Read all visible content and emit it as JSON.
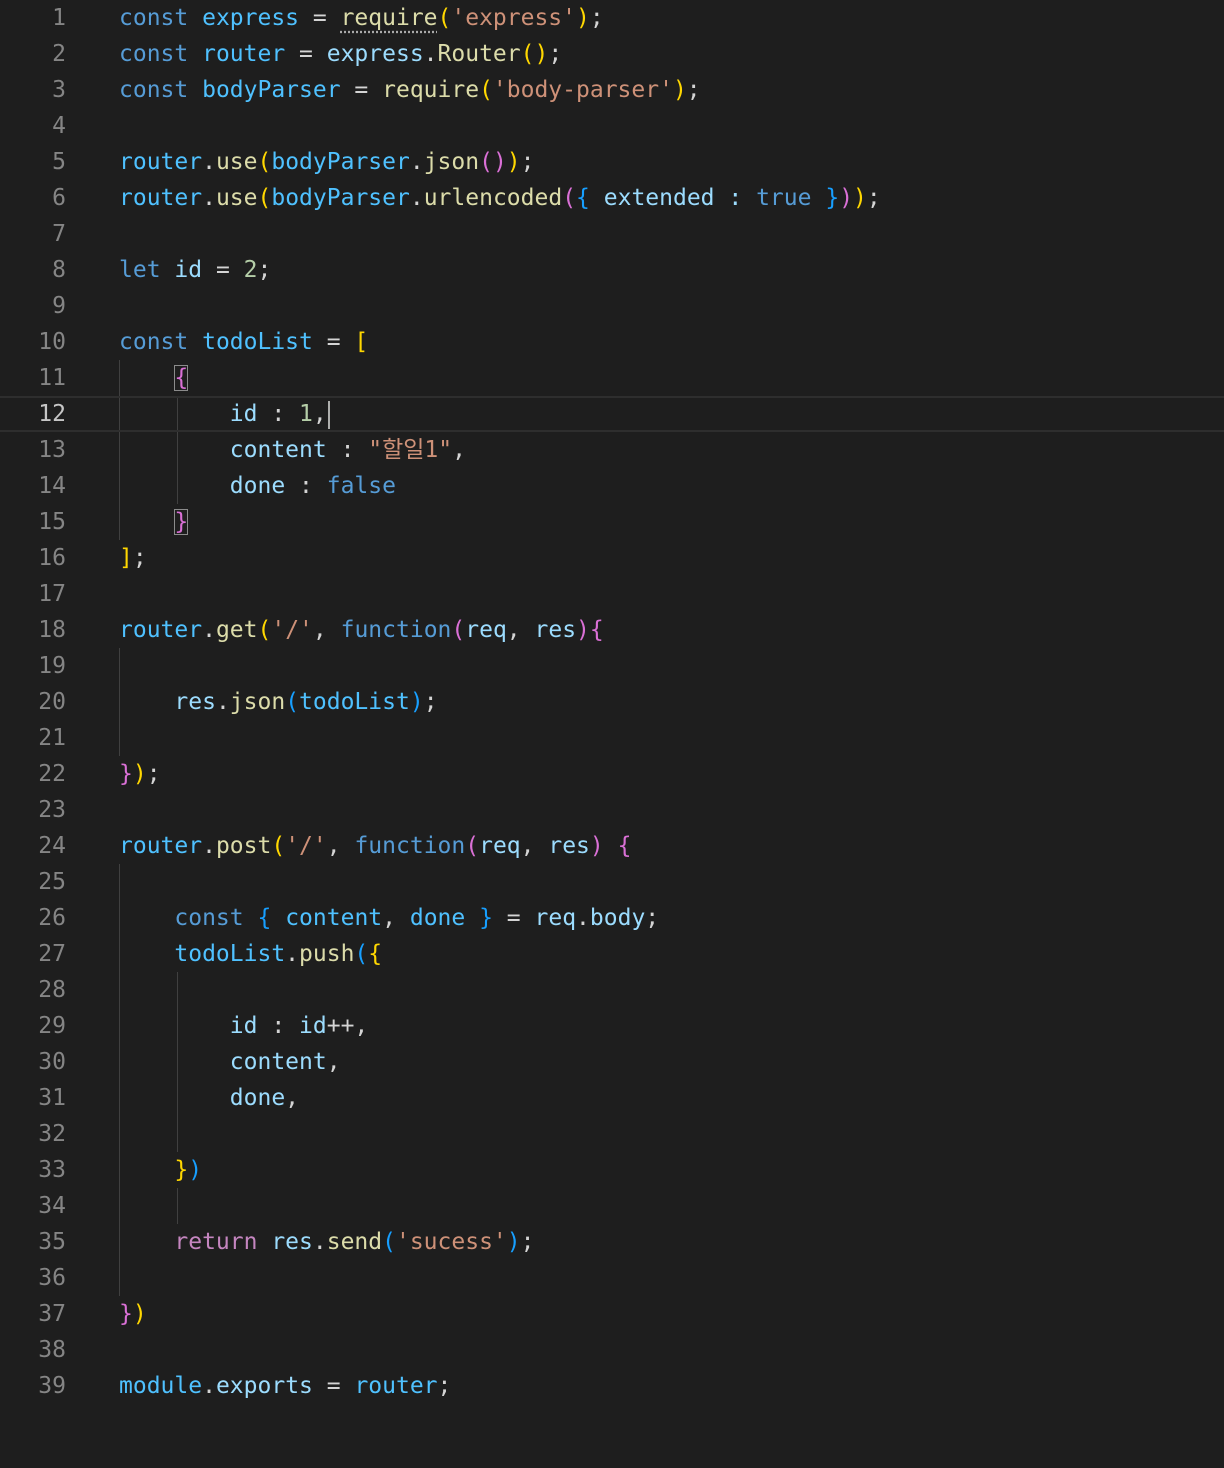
{
  "editor": {
    "current_line": 12,
    "lines": [
      {
        "n": "1",
        "t": [
          [
            "const ",
            "kw"
          ],
          [
            "express",
            "cst"
          ],
          [
            " = ",
            "pun"
          ],
          [
            "require",
            "fn",
            "dots"
          ],
          [
            "(",
            "b1"
          ],
          [
            "'express'",
            "str"
          ],
          [
            ")",
            "b1"
          ],
          [
            ";",
            "pun"
          ]
        ]
      },
      {
        "n": "2",
        "t": [
          [
            "const ",
            "kw"
          ],
          [
            "router",
            "cst"
          ],
          [
            " = ",
            "pun"
          ],
          [
            "express",
            "var"
          ],
          [
            ".",
            "pun"
          ],
          [
            "Router",
            "fn"
          ],
          [
            "()",
            "b1"
          ],
          [
            ";",
            "pun"
          ]
        ]
      },
      {
        "n": "3",
        "t": [
          [
            "const ",
            "kw"
          ],
          [
            "bodyParser",
            "cst"
          ],
          [
            " = ",
            "pun"
          ],
          [
            "require",
            "fn"
          ],
          [
            "(",
            "b1"
          ],
          [
            "'body-parser'",
            "str"
          ],
          [
            ")",
            "b1"
          ],
          [
            ";",
            "pun"
          ]
        ]
      },
      {
        "n": "4",
        "t": []
      },
      {
        "n": "5",
        "t": [
          [
            "router",
            "cst"
          ],
          [
            ".",
            "pun"
          ],
          [
            "use",
            "fn"
          ],
          [
            "(",
            "b1"
          ],
          [
            "bodyParser",
            "cst"
          ],
          [
            ".",
            "pun"
          ],
          [
            "json",
            "fn"
          ],
          [
            "()",
            "b2"
          ],
          [
            ")",
            "b1"
          ],
          [
            ";",
            "pun"
          ]
        ]
      },
      {
        "n": "6",
        "t": [
          [
            "router",
            "cst"
          ],
          [
            ".",
            "pun"
          ],
          [
            "use",
            "fn"
          ],
          [
            "(",
            "b1"
          ],
          [
            "bodyParser",
            "cst"
          ],
          [
            ".",
            "pun"
          ],
          [
            "urlencoded",
            "fn"
          ],
          [
            "(",
            "b2"
          ],
          [
            "{",
            "b3"
          ],
          [
            " extended : ",
            "var"
          ],
          [
            "true",
            "kw"
          ],
          [
            " ",
            "pun"
          ],
          [
            "}",
            "b3"
          ],
          [
            ")",
            "b2"
          ],
          [
            ")",
            "b1"
          ],
          [
            ";",
            "pun"
          ]
        ]
      },
      {
        "n": "7",
        "t": []
      },
      {
        "n": "8",
        "t": [
          [
            "let ",
            "kw"
          ],
          [
            "id",
            "var"
          ],
          [
            " = ",
            "pun"
          ],
          [
            "2",
            "num"
          ],
          [
            ";",
            "pun"
          ]
        ]
      },
      {
        "n": "9",
        "t": []
      },
      {
        "n": "10",
        "t": [
          [
            "const ",
            "kw"
          ],
          [
            "todoList",
            "cst"
          ],
          [
            " = ",
            "pun"
          ],
          [
            "[",
            "b1"
          ]
        ]
      },
      {
        "n": "11",
        "t": [
          [
            "    ",
            "pun"
          ],
          [
            "{",
            "b2",
            "bm"
          ]
        ]
      },
      {
        "n": "12",
        "t": [
          [
            "        ",
            "pun"
          ],
          [
            "id",
            "var"
          ],
          [
            " : ",
            "pun"
          ],
          [
            "1",
            "num"
          ],
          [
            ",",
            "pun"
          ]
        ],
        "cursor": true
      },
      {
        "n": "13",
        "t": [
          [
            "        ",
            "pun"
          ],
          [
            "content",
            "var"
          ],
          [
            " : ",
            "pun"
          ],
          [
            "\"할일1\"",
            "str"
          ],
          [
            ",",
            "pun"
          ]
        ]
      },
      {
        "n": "14",
        "t": [
          [
            "        ",
            "pun"
          ],
          [
            "done",
            "var"
          ],
          [
            " : ",
            "pun"
          ],
          [
            "false",
            "kw"
          ]
        ]
      },
      {
        "n": "15",
        "t": [
          [
            "    ",
            "pun"
          ],
          [
            "}",
            "b2",
            "bm"
          ]
        ]
      },
      {
        "n": "16",
        "t": [
          [
            "]",
            "b1"
          ],
          [
            ";",
            "pun"
          ]
        ]
      },
      {
        "n": "17",
        "t": []
      },
      {
        "n": "18",
        "t": [
          [
            "router",
            "cst"
          ],
          [
            ".",
            "pun"
          ],
          [
            "get",
            "fn"
          ],
          [
            "(",
            "b1"
          ],
          [
            "'/'",
            "str"
          ],
          [
            ", ",
            "pun"
          ],
          [
            "function",
            "kw"
          ],
          [
            "(",
            "b2"
          ],
          [
            "req",
            "var"
          ],
          [
            ", ",
            "pun"
          ],
          [
            "res",
            "var"
          ],
          [
            ")",
            "b2"
          ],
          [
            "{",
            "b2"
          ]
        ]
      },
      {
        "n": "19",
        "t": []
      },
      {
        "n": "20",
        "t": [
          [
            "    ",
            "pun"
          ],
          [
            "res",
            "var"
          ],
          [
            ".",
            "pun"
          ],
          [
            "json",
            "fn"
          ],
          [
            "(",
            "b3"
          ],
          [
            "todoList",
            "cst"
          ],
          [
            ")",
            "b3"
          ],
          [
            ";",
            "pun"
          ]
        ]
      },
      {
        "n": "21",
        "t": []
      },
      {
        "n": "22",
        "t": [
          [
            "}",
            "b2"
          ],
          [
            ")",
            "b1"
          ],
          [
            ";",
            "pun"
          ]
        ]
      },
      {
        "n": "23",
        "t": []
      },
      {
        "n": "24",
        "t": [
          [
            "router",
            "cst"
          ],
          [
            ".",
            "pun"
          ],
          [
            "post",
            "fn"
          ],
          [
            "(",
            "b1"
          ],
          [
            "'/'",
            "str"
          ],
          [
            ", ",
            "pun"
          ],
          [
            "function",
            "kw"
          ],
          [
            "(",
            "b2"
          ],
          [
            "req",
            "var"
          ],
          [
            ", ",
            "pun"
          ],
          [
            "res",
            "var"
          ],
          [
            ")",
            "b2"
          ],
          [
            " ",
            "pun"
          ],
          [
            "{",
            "b2"
          ]
        ]
      },
      {
        "n": "25",
        "t": []
      },
      {
        "n": "26",
        "t": [
          [
            "    ",
            "pun"
          ],
          [
            "const ",
            "kw"
          ],
          [
            "{",
            "b3"
          ],
          [
            " ",
            "pun"
          ],
          [
            "content",
            "cst"
          ],
          [
            ", ",
            "pun"
          ],
          [
            "done",
            "cst"
          ],
          [
            " ",
            "pun"
          ],
          [
            "}",
            "b3"
          ],
          [
            " = ",
            "pun"
          ],
          [
            "req",
            "var"
          ],
          [
            ".",
            "pun"
          ],
          [
            "body",
            "var"
          ],
          [
            ";",
            "pun"
          ]
        ]
      },
      {
        "n": "27",
        "t": [
          [
            "    ",
            "pun"
          ],
          [
            "todoList",
            "cst"
          ],
          [
            ".",
            "pun"
          ],
          [
            "push",
            "fn"
          ],
          [
            "(",
            "b3"
          ],
          [
            "{",
            "b1"
          ]
        ]
      },
      {
        "n": "28",
        "t": []
      },
      {
        "n": "29",
        "t": [
          [
            "        ",
            "pun"
          ],
          [
            "id",
            "var"
          ],
          [
            " : ",
            "pun"
          ],
          [
            "id",
            "var"
          ],
          [
            "++,",
            "pun"
          ]
        ]
      },
      {
        "n": "30",
        "t": [
          [
            "        ",
            "pun"
          ],
          [
            "content",
            "var"
          ],
          [
            ",",
            "pun"
          ]
        ]
      },
      {
        "n": "31",
        "t": [
          [
            "        ",
            "pun"
          ],
          [
            "done",
            "var"
          ],
          [
            ",",
            "pun"
          ]
        ]
      },
      {
        "n": "32",
        "t": []
      },
      {
        "n": "33",
        "t": [
          [
            "    ",
            "pun"
          ],
          [
            "}",
            "b1"
          ],
          [
            ")",
            "b3"
          ]
        ]
      },
      {
        "n": "34",
        "t": []
      },
      {
        "n": "35",
        "t": [
          [
            "    ",
            "pun"
          ],
          [
            "return ",
            "ctl"
          ],
          [
            "res",
            "var"
          ],
          [
            ".",
            "pun"
          ],
          [
            "send",
            "fn"
          ],
          [
            "(",
            "b3"
          ],
          [
            "'sucess'",
            "str"
          ],
          [
            ")",
            "b3"
          ],
          [
            ";",
            "pun"
          ]
        ]
      },
      {
        "n": "36",
        "t": []
      },
      {
        "n": "37",
        "t": [
          [
            "}",
            "b2"
          ],
          [
            ")",
            "b1"
          ]
        ]
      },
      {
        "n": "38",
        "t": []
      },
      {
        "n": "39",
        "t": [
          [
            "module",
            "cst"
          ],
          [
            ".",
            "pun"
          ],
          [
            "exports",
            "var"
          ],
          [
            " = ",
            "pun"
          ],
          [
            "router",
            "cst"
          ],
          [
            ";",
            "pun"
          ]
        ]
      }
    ]
  },
  "colors": {
    "background": "#1e1e1e",
    "line_number": "#858585",
    "keyword": "#569cd6",
    "variable": "#9cdcfe",
    "constant": "#4fc1ff",
    "function": "#dcdcaa",
    "string": "#ce9178",
    "number": "#b5cea8",
    "bracket_gold": "#ffd700",
    "bracket_orchid": "#da70d6",
    "bracket_blue": "#179fff"
  }
}
